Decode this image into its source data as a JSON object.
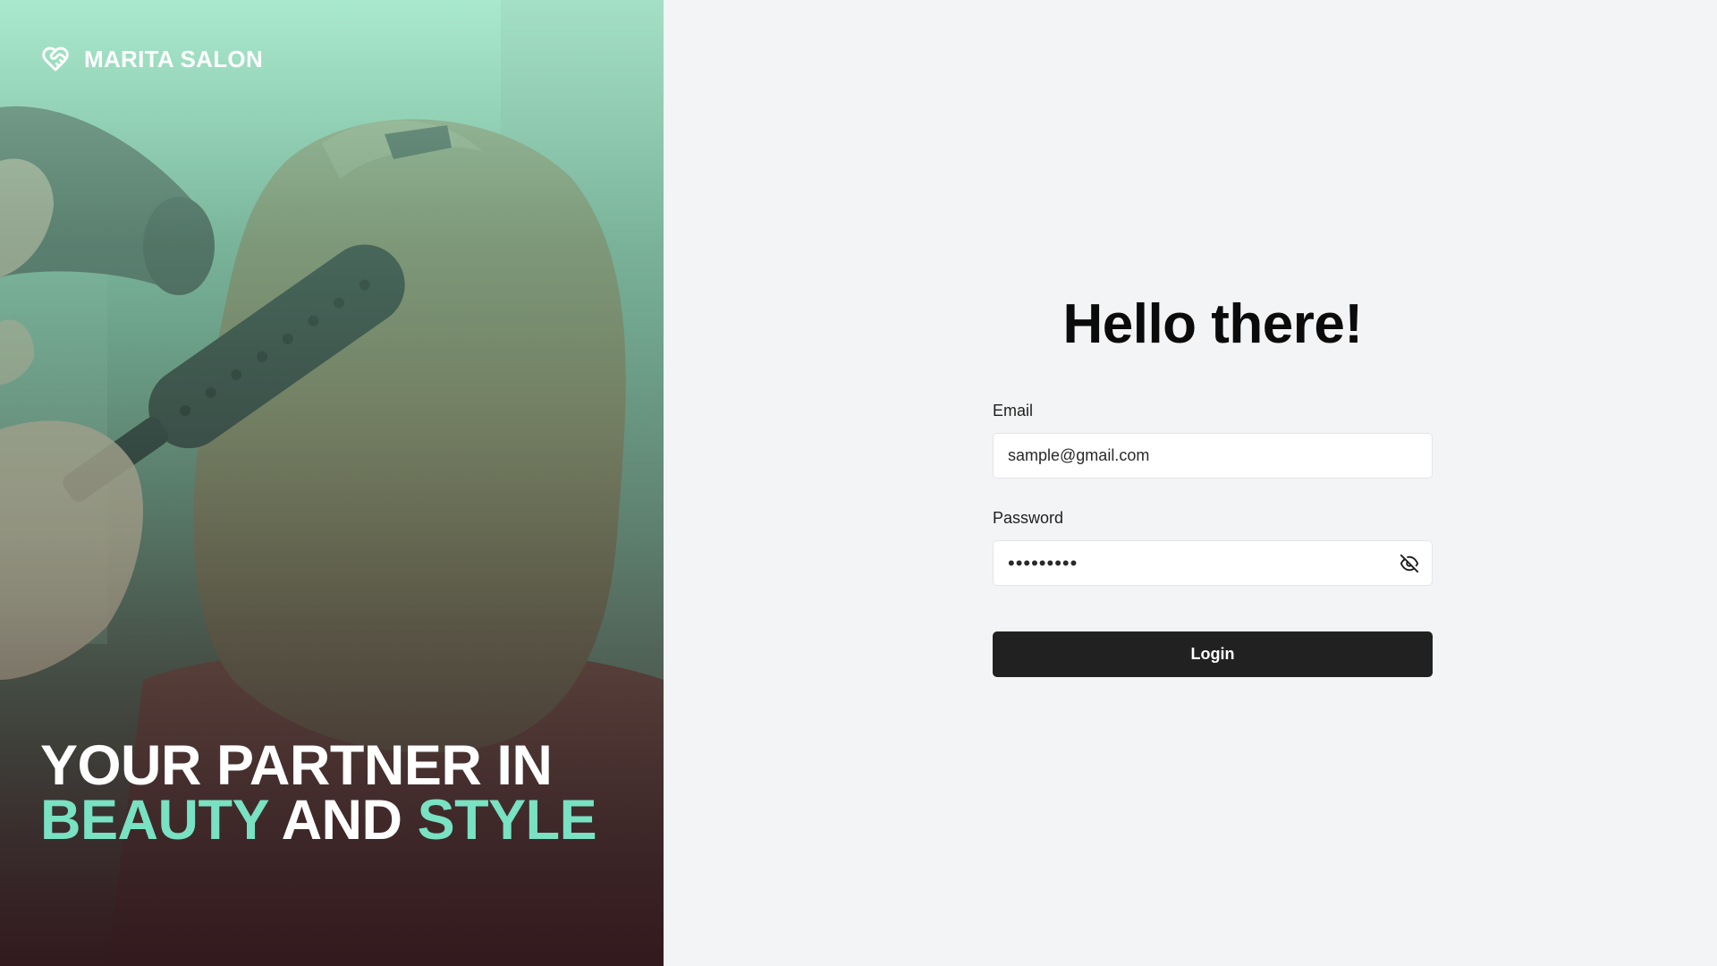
{
  "brand": {
    "name": "MARITA SALON",
    "icon": "heart-handshake-icon"
  },
  "hero": {
    "tagline_line1": "YOUR PARTNER IN",
    "tagline_word_beauty": "BEAUTY",
    "tagline_word_and": "AND",
    "tagline_word_style": "STYLE",
    "image": "hairstylist-blow-drying-hair-photo"
  },
  "login": {
    "title": "Hello there!",
    "email_label": "Email",
    "email_value": "sample@gmail.com",
    "password_label": "Password",
    "password_value": "•••••••••",
    "password_toggle_icon": "eye-off-icon",
    "submit_label": "Login"
  },
  "colors": {
    "accent": "#78e2c2",
    "button": "#212121",
    "background": "#f3f4f6"
  }
}
